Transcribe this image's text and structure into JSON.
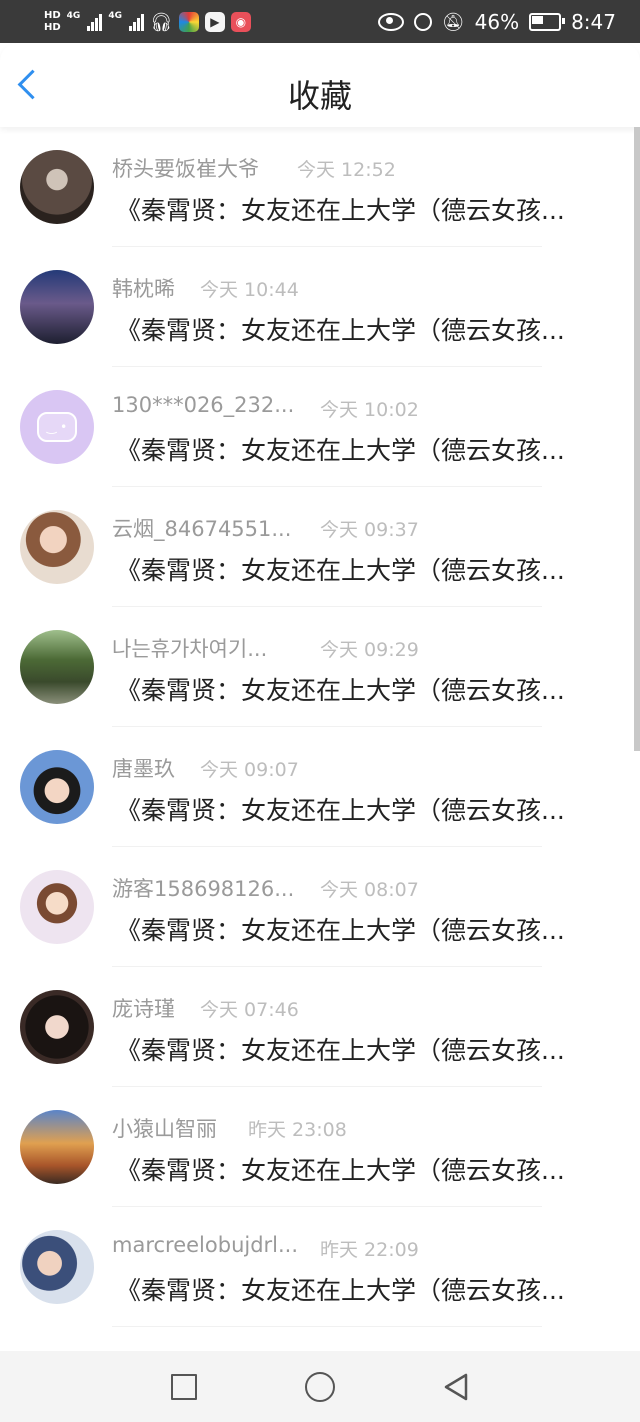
{
  "status_bar": {
    "hd_top": "HD",
    "hd_bottom": "HD",
    "net1": "4G",
    "net2": "4G",
    "battery_level": "46%",
    "time": "8:47"
  },
  "header": {
    "title": "收藏",
    "back_icon": "chevron-left-icon"
  },
  "list": {
    "items": [
      {
        "name": "桥头要饭崔大爷",
        "time": "今天 12:52",
        "message": "《秦霄贤：女友还在上大学（德云女孩...",
        "avatar_color": "#4a3a34"
      },
      {
        "name": "韩枕晞",
        "time": "今天 10:44",
        "message": "《秦霄贤：女友还在上大学（德云女孩...",
        "avatar_color": "#2b3f78"
      },
      {
        "name": "130***026_232...",
        "time": "今天 10:02",
        "message": "《秦霄贤：女友还在上大学（德云女孩...",
        "avatar_color": "#d6c2f0"
      },
      {
        "name": "云烟_84674551...",
        "time": "今天 09:37",
        "message": "《秦霄贤：女友还在上大学（德云女孩...",
        "avatar_color": "#b58a6c"
      },
      {
        "name": "나는휴가차여기...",
        "time": "今天 09:29",
        "message": "《秦霄贤：女友还在上大学（德云女孩...",
        "avatar_color": "#4f6a3f"
      },
      {
        "name": "唐墨玖",
        "time": "今天 09:07",
        "message": "《秦霄贤：女友还在上大学（德云女孩...",
        "avatar_color": "#5a86c4"
      },
      {
        "name": "游客158698126...",
        "time": "今天 08:07",
        "message": "《秦霄贤：女友还在上大学（德云女孩...",
        "avatar_color": "#e9d7cf"
      },
      {
        "name": "庞诗瑾",
        "time": "今天 07:46",
        "message": "《秦霄贤：女友还在上大学（德云女孩...",
        "avatar_color": "#3a2a26"
      },
      {
        "name": "小猿山智丽",
        "time": "昨天 23:08",
        "message": "《秦霄贤：女友还在上大学（德云女孩...",
        "avatar_color": "#c97f37"
      },
      {
        "name": "marcreelobujdrl...",
        "time": "昨天 22:09",
        "message": "《秦霄贤：女友还在上大学（德云女孩...",
        "avatar_color": "#7fa1c9"
      }
    ]
  },
  "navbar": {
    "recent_icon": "square-icon",
    "home_icon": "circle-icon",
    "back_icon": "triangle-back-icon"
  }
}
